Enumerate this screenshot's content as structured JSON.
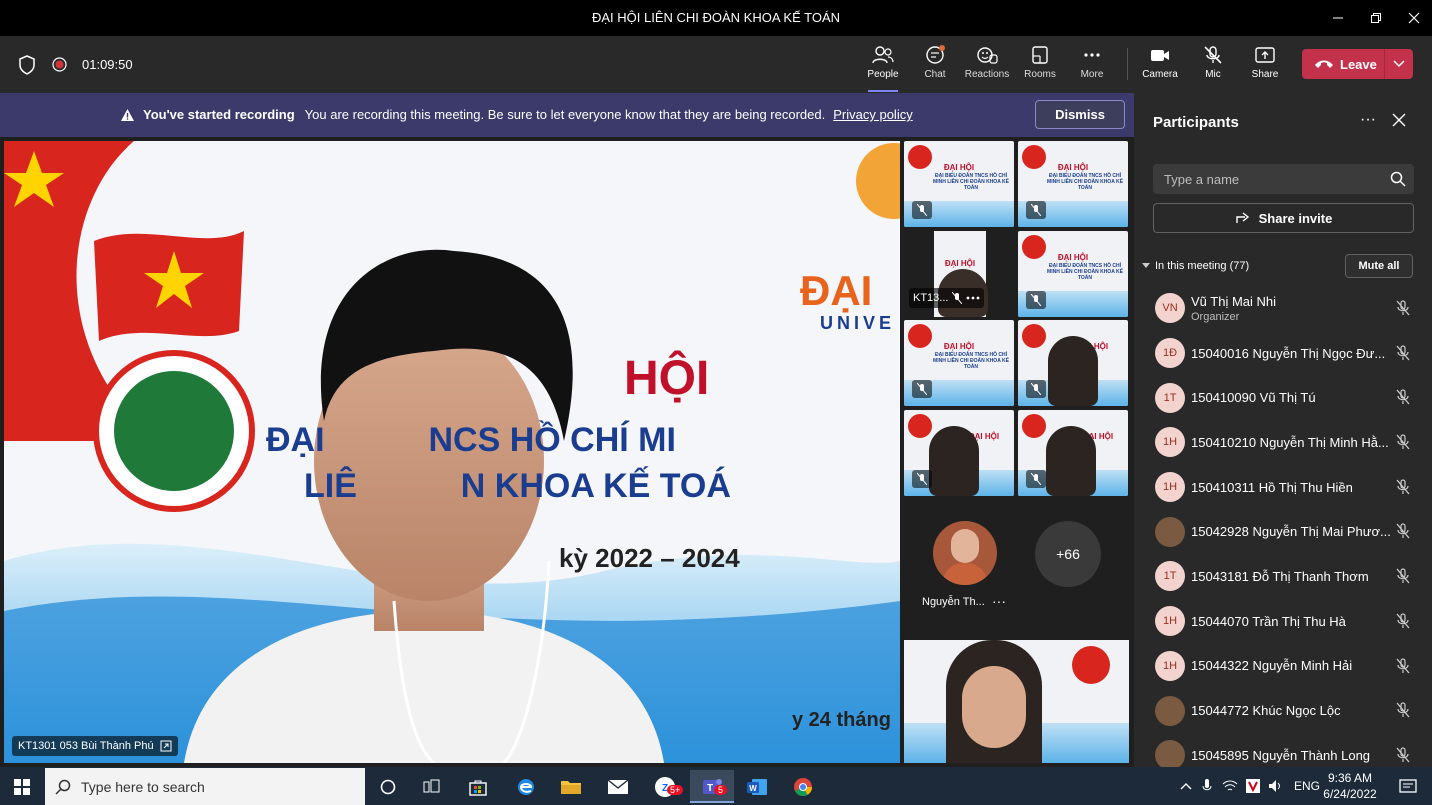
{
  "window": {
    "title": "ĐẠI HỘI LIÊN CHI ĐOÀN KHOA KẾ TOÁN"
  },
  "toolbar": {
    "timer": "01:09:50",
    "people_label": "People",
    "chat_label": "Chat",
    "reactions_label": "Reactions",
    "rooms_label": "Rooms",
    "more_label": "More",
    "camera_label": "Camera",
    "mic_label": "Mic",
    "share_label": "Share",
    "leave_label": "Leave"
  },
  "banner": {
    "title": "You've started recording",
    "message": "You are recording this meeting. Be sure to let everyone know that they are being recorded.",
    "link": "Privacy policy",
    "dismiss_label": "Dismiss"
  },
  "main_video": {
    "speaker_label": "KT1301 053 Bùi Thành Phú",
    "slide_title": "HỘI",
    "slide_line1": "ĐẠI           NCS HỒ CHÍ MI",
    "slide_line2": "LIÊ           N KHOA KẾ TOÁ",
    "slide_term": "kỳ 2022 – 2024",
    "slide_brand": "ĐẠI",
    "slide_brand2": "UNIVE",
    "slide_date": "y 24 tháng"
  },
  "grid": {
    "tile_title": "ĐẠI HỘI",
    "tile_sub": "ĐẠI BIỂU ĐOÀN TNCS HỒ CHÍ MINH LIÊN CHI ĐOÀN KHOA KẾ TOÁN",
    "tile_label_small": "KT13...",
    "avatar_name": "Nguyễn Th...",
    "overflow_count": "+66"
  },
  "participants": {
    "title": "Participants",
    "search_placeholder": "Type a name",
    "share_invite_label": "Share invite",
    "in_meeting_label": "In this meeting (77)",
    "mute_all_label": "Mute all",
    "list": [
      {
        "initials": "VN",
        "name": "Vũ Thị Mai Nhi",
        "role": "Organizer"
      },
      {
        "initials": "1Đ",
        "name": "15040016 Nguyễn Thị Ngọc Đư..."
      },
      {
        "initials": "1T",
        "name": "150410090 Vũ Thị Tú"
      },
      {
        "initials": "1H",
        "name": "150410210 Nguyễn Thị Minh Hằ..."
      },
      {
        "initials": "1H",
        "name": "150410311 Hồ Thị Thu Hiền"
      },
      {
        "initials": "",
        "name": "15042928 Nguyễn Thị Mai Phươ..."
      },
      {
        "initials": "1T",
        "name": "15043181 Đỗ Thị Thanh Thơm"
      },
      {
        "initials": "1H",
        "name": "15044070 Trần Thị Thu Hà"
      },
      {
        "initials": "1H",
        "name": "15044322 Nguyễn Minh Hải"
      },
      {
        "initials": "",
        "name": "15044772 Khúc Ngọc Lộc"
      },
      {
        "initials": "",
        "name": "15045895 Nguyễn Thành Long"
      }
    ]
  },
  "taskbar": {
    "search_placeholder": "Type here to search",
    "zalo_badge": "5+",
    "teams_badge": "5",
    "lang": "ENG",
    "time": "9:36 AM",
    "date": "6/24/2022"
  },
  "colors": {
    "leave": "#c4314b",
    "banner": "#3b3a6b",
    "panel": "#292929",
    "taskbar": "#1c2a3a"
  }
}
